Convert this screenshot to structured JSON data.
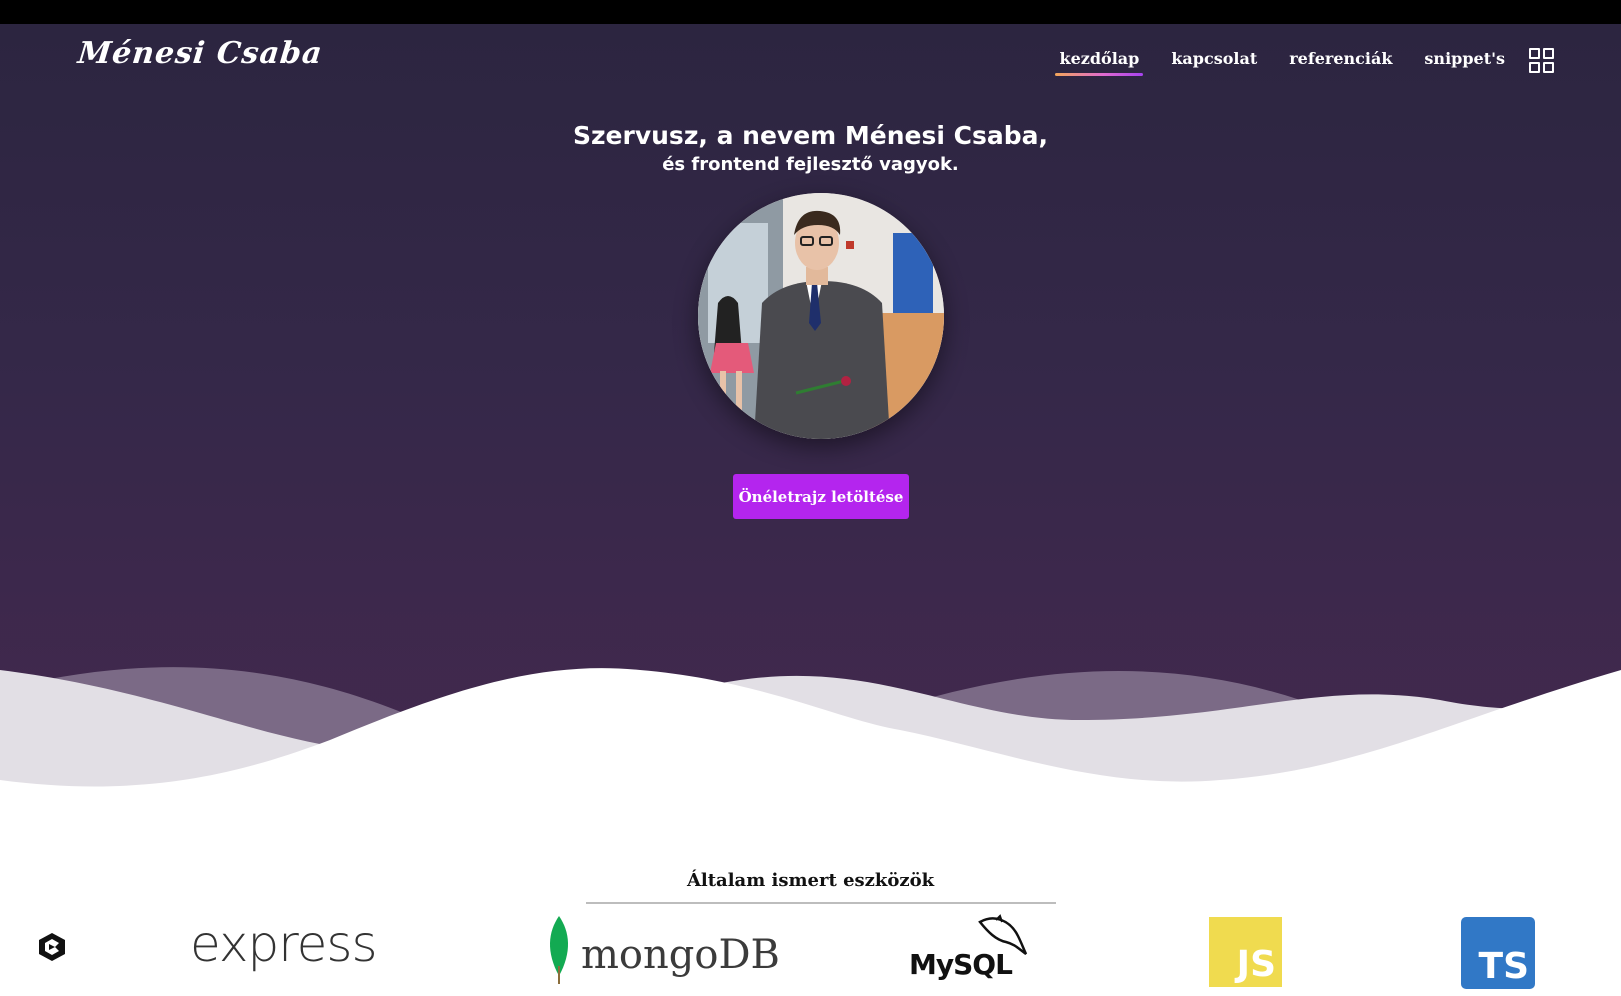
{
  "header": {
    "logo_text": "Ménesi Csaba",
    "nav": [
      {
        "label": "kezdőlap",
        "active": true
      },
      {
        "label": "kapcsolat",
        "active": false
      },
      {
        "label": "referenciák",
        "active": false
      },
      {
        "label": "snippet's",
        "active": false
      }
    ],
    "menu_icon": "grid-icon"
  },
  "hero": {
    "greeting": "Szervusz, a nevem Ménesi Csaba,",
    "subtitle": "és frontend fejlesztő vagyok.",
    "cv_button_label": "Önéletrajz letöltése"
  },
  "tools": {
    "title": "Általam ismert eszközök",
    "items": [
      {
        "name": "codepen-icon"
      },
      {
        "name": "express-logo",
        "label": "express"
      },
      {
        "name": "mongodb-logo",
        "label": "mongoDB"
      },
      {
        "name": "mysql-logo",
        "label": "MySQL"
      },
      {
        "name": "javascript-logo",
        "label": "JS"
      },
      {
        "name": "typescript-logo",
        "label": "TS"
      }
    ]
  },
  "colors": {
    "hero_top": "#2c2540",
    "hero_bottom": "#45294f",
    "accent_purple": "#b425ee",
    "js_yellow": "#f0db4f",
    "ts_blue": "#3178c6",
    "mongo_green": "#13aa52"
  }
}
